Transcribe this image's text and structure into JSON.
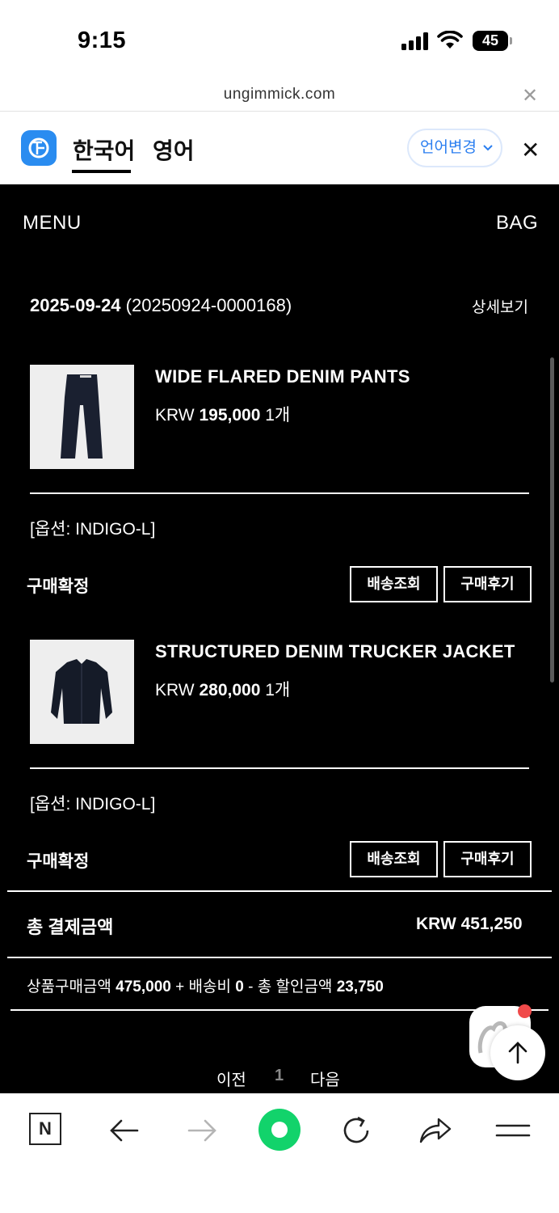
{
  "status_bar": {
    "time": "9:15",
    "battery": "45"
  },
  "browser": {
    "url": "ungimmick.com",
    "close_symbol": "✕"
  },
  "translate": {
    "tab_korean": "한국어",
    "tab_english": "영어",
    "change_language": "언어변경",
    "close_symbol": "✕",
    "accent_color": "#2a8cf0"
  },
  "header": {
    "menu": "MENU",
    "bag": "BAG"
  },
  "order": {
    "date": "2025-09-24",
    "number": "(20250924-0000168)",
    "detail_link": "상세보기",
    "items": [
      {
        "name": "WIDE FLARED DENIM PANTS",
        "currency": "KRW",
        "price": "195,000",
        "qty": "1개",
        "option": "[옵션: INDIGO-L]",
        "status": "구매확정",
        "btn_track": "배송조회",
        "btn_review": "구매후기"
      },
      {
        "name": "STRUCTURED DENIM TRUCKER JACKET",
        "currency": "KRW",
        "price": "280,000",
        "qty": "1개",
        "option": "[옵션: INDIGO-L]",
        "status": "구매확정",
        "btn_track": "배송조회",
        "btn_review": "구매후기"
      }
    ],
    "total_label": "총 결제금액",
    "total_value": "KRW 451,250",
    "breakdown": {
      "product_label": "상품구매금액",
      "product_amount": "475,000",
      "plus": "+",
      "shipping_label": "배송비",
      "shipping_amount": "0",
      "minus": "-",
      "discount_label": "총 할인금액",
      "discount_amount": "23,750"
    }
  },
  "pagination": {
    "prev": "이전",
    "current": "1",
    "next": "다음"
  },
  "toolbar": {
    "naver_letter": "N"
  }
}
